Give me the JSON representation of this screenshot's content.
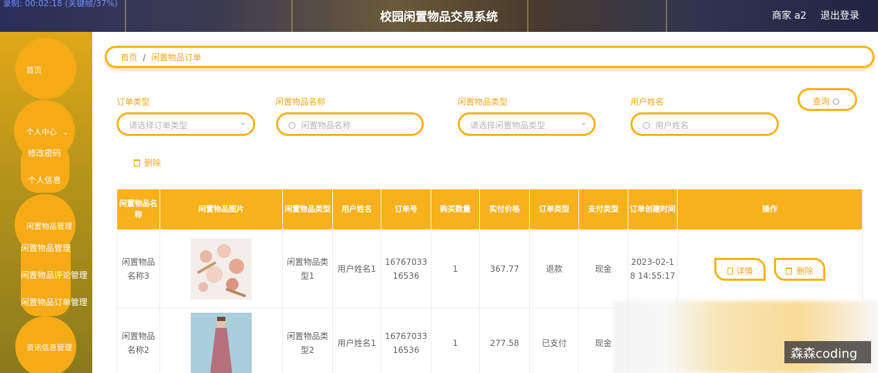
{
  "header": {
    "recording_text": "录制: 00:02:18 (关键帧/37%)",
    "system_title": "校园闲置物品交易系统",
    "user_label": "商家 a2",
    "logout_label": "退出登录"
  },
  "sidebar": {
    "home": "首页",
    "personal_center": "个人中心",
    "change_password": "修改密码",
    "personal_info": "个人信息",
    "item_mgmt_group": "闲置物品管理",
    "item_mgmt": "闲置物品管理",
    "item_comment_mgmt": "闲置物品评论管理",
    "item_order_mgmt": "闲置物品订单管理",
    "news_mgmt": "资讯信息管理"
  },
  "breadcrumb": {
    "home": "首页",
    "sep": "/",
    "current": "闲置物品订单"
  },
  "filters": {
    "order_type": {
      "label": "订单类型",
      "placeholder": "请选择订单类型"
    },
    "item_name": {
      "label": "闲置物品名称",
      "placeholder": "闲置物品名称"
    },
    "item_type": {
      "label": "闲置物品类型",
      "placeholder": "请选择闲置物品类型"
    },
    "user_name": {
      "label": "用户姓名",
      "placeholder": "用户姓名"
    },
    "query_label": "查询",
    "delete_label": "删除"
  },
  "table": {
    "headers": [
      "闲置物品名称",
      "闲置物品图片",
      "闲置物品类型",
      "用户姓名",
      "订单号",
      "购买数量",
      "实付价格",
      "订单类型",
      "支付类型",
      "订单创建时间",
      "操作"
    ],
    "rows": [
      {
        "name": "闲置物品名称3",
        "type": "闲置物品类型1",
        "user": "用户姓名1",
        "order_no": "1676703316536",
        "qty": "1",
        "price": "367.77",
        "order_type": "退款",
        "pay_type": "现金",
        "created": "2023-02-18 14:55:17",
        "detail_label": "详情",
        "delete_label": "删除"
      },
      {
        "name": "闲置物品名称2",
        "type": "闲置物品类型2",
        "user": "用户姓名1",
        "order_no": "1676703316536",
        "qty": "1",
        "price": "277.58",
        "order_type": "已支付",
        "pay_type": "现金"
      }
    ]
  },
  "watermark": "森森coding",
  "colors": {
    "accent": "#f7b11c",
    "accent_text": "#f4a617",
    "sidebar_blob": "#f5ab16"
  }
}
